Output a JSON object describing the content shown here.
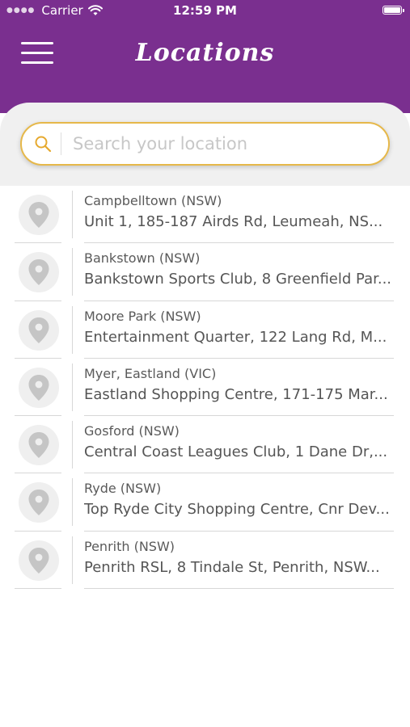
{
  "status_bar": {
    "carrier": "Carrier",
    "time": "12:59 PM"
  },
  "header": {
    "title": "Locations"
  },
  "search": {
    "placeholder": "Search your location",
    "value": ""
  },
  "locations": [
    {
      "name": "Campbelltown (NSW)",
      "address": "Unit 1, 185-187 Airds Rd, Leumeah, NS..."
    },
    {
      "name": "Bankstown (NSW)",
      "address": "Bankstown Sports Club, 8 Greenfield Par..."
    },
    {
      "name": "Moore Park (NSW)",
      "address": "Entertainment Quarter, 122 Lang Rd, M..."
    },
    {
      "name": "Myer, Eastland (VIC)",
      "address": "Eastland Shopping Centre, 171-175 Mar..."
    },
    {
      "name": "Gosford (NSW)",
      "address": "Central Coast Leagues Club, 1 Dane Dr,..."
    },
    {
      "name": "Ryde (NSW)",
      "address": "Top Ryde City Shopping Centre, Cnr Dev..."
    },
    {
      "name": "Penrith (NSW)",
      "address": "Penrith RSL, 8 Tindale St, Penrith, NSW..."
    }
  ],
  "icons": {
    "menu": "hamburger-menu-icon",
    "search": "search-icon",
    "location": "location-pin-icon",
    "wifi": "wifi-icon",
    "battery": "battery-icon"
  },
  "colors": {
    "header_background": "#7a2f8f",
    "search_border": "#e6b84a",
    "search_background_band": "#f0f0f0"
  }
}
